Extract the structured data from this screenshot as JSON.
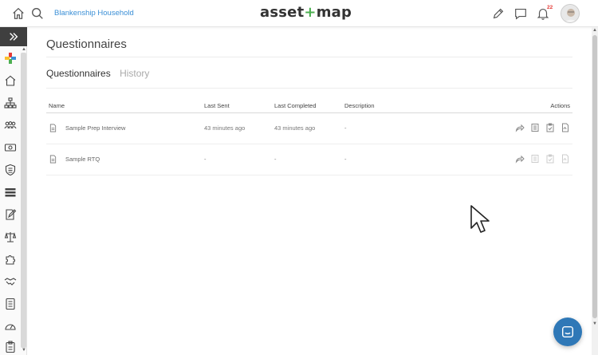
{
  "header": {
    "household": "Blankenship Household",
    "logo_left": "asset",
    "logo_plus": "+",
    "logo_right": "map",
    "notification_count": "22"
  },
  "page": {
    "title": "Questionnaires",
    "tabs": [
      {
        "label": "Questionnaires",
        "active": true
      },
      {
        "label": "History",
        "active": false
      }
    ]
  },
  "table": {
    "columns": [
      "Name",
      "Last Sent",
      "Last Completed",
      "Description",
      "Actions"
    ],
    "rows": [
      {
        "name": "Sample Prep Interview",
        "last_sent": "43 minutes ago",
        "last_completed": "43 minutes ago",
        "description": "-"
      },
      {
        "name": "Sample RTQ",
        "last_sent": "-",
        "last_completed": "-",
        "description": "-"
      }
    ]
  },
  "icons": {
    "brand_plus_colors": [
      "#e53935",
      "#4caf50",
      "#3a8fd6",
      "#fbc02d"
    ],
    "accent": "#3a8fd6",
    "chat_bg": "#2f78b7"
  }
}
